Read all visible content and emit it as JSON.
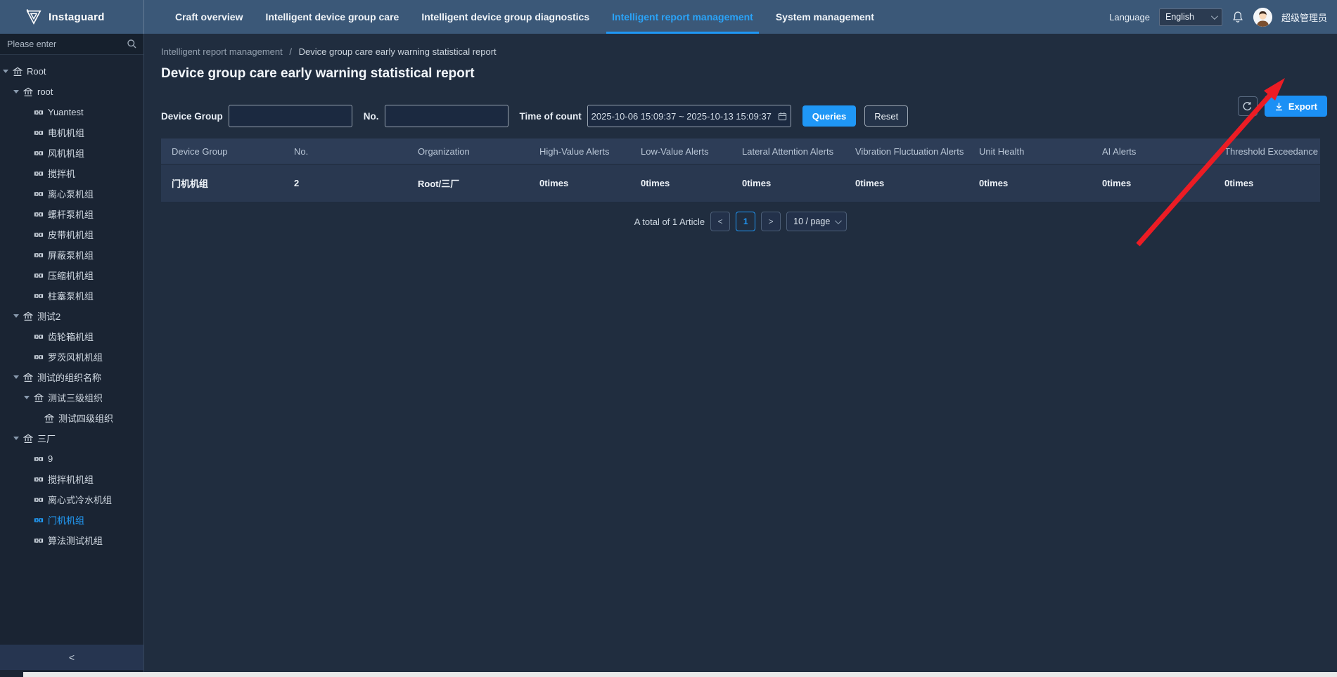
{
  "nav": {
    "logo_text": "Instaguard",
    "items": [
      {
        "label": "Craft overview",
        "active": false
      },
      {
        "label": "Intelligent device group care",
        "active": false
      },
      {
        "label": "Intelligent device group diagnostics",
        "active": false
      },
      {
        "label": "Intelligent report management",
        "active": true
      },
      {
        "label": "System management",
        "active": false
      }
    ],
    "language_label": "Language",
    "language_value": "English",
    "user_name": "超级管理员"
  },
  "sidebar": {
    "search_placeholder": "Please enter",
    "collapse_label": "<",
    "tree": [
      {
        "label": "Root",
        "level": 0,
        "icon": "org",
        "caret": true,
        "selected": false
      },
      {
        "label": "root",
        "level": 1,
        "icon": "org",
        "caret": true,
        "selected": false
      },
      {
        "label": "Yuantest",
        "level": 2,
        "icon": "device",
        "caret": false,
        "selected": false
      },
      {
        "label": "电机机组",
        "level": 2,
        "icon": "device",
        "caret": false,
        "selected": false
      },
      {
        "label": "风机机组",
        "level": 2,
        "icon": "device",
        "caret": false,
        "selected": false
      },
      {
        "label": "搅拌机",
        "level": 2,
        "icon": "device",
        "caret": false,
        "selected": false
      },
      {
        "label": "离心泵机组",
        "level": 2,
        "icon": "device",
        "caret": false,
        "selected": false
      },
      {
        "label": "螺杆泵机组",
        "level": 2,
        "icon": "device",
        "caret": false,
        "selected": false
      },
      {
        "label": "皮带机机组",
        "level": 2,
        "icon": "device",
        "caret": false,
        "selected": false
      },
      {
        "label": "屏蔽泵机组",
        "level": 2,
        "icon": "device",
        "caret": false,
        "selected": false
      },
      {
        "label": "压缩机机组",
        "level": 2,
        "icon": "device",
        "caret": false,
        "selected": false
      },
      {
        "label": "柱塞泵机组",
        "level": 2,
        "icon": "device",
        "caret": false,
        "selected": false
      },
      {
        "label": "测试2",
        "level": 1,
        "icon": "org",
        "caret": true,
        "selected": false
      },
      {
        "label": "齿轮箱机组",
        "level": 2,
        "icon": "device",
        "caret": false,
        "selected": false
      },
      {
        "label": "罗茨风机机组",
        "level": 2,
        "icon": "device",
        "caret": false,
        "selected": false
      },
      {
        "label": "测试的组织名称",
        "level": 1,
        "icon": "org",
        "caret": true,
        "selected": false
      },
      {
        "label": "测试三级组织",
        "level": 2,
        "icon": "org",
        "caret": true,
        "selected": false
      },
      {
        "label": "测试四级组织",
        "level": 3,
        "icon": "org",
        "caret": false,
        "selected": false
      },
      {
        "label": "三厂",
        "level": 1,
        "icon": "org",
        "caret": true,
        "selected": false
      },
      {
        "label": "9",
        "level": 2,
        "icon": "device",
        "caret": false,
        "selected": false
      },
      {
        "label": "搅拌机机组",
        "level": 2,
        "icon": "device",
        "caret": false,
        "selected": false
      },
      {
        "label": "离心式冷水机组",
        "level": 2,
        "icon": "device",
        "caret": false,
        "selected": false
      },
      {
        "label": "门机机组",
        "level": 2,
        "icon": "device",
        "caret": false,
        "selected": true
      },
      {
        "label": "算法测试机组",
        "level": 2,
        "icon": "device",
        "caret": false,
        "selected": false
      }
    ]
  },
  "breadcrumb": {
    "parent": "Intelligent report management",
    "separator": "/",
    "current": "Device group care early warning statistical report"
  },
  "page": {
    "title": "Device group care early warning statistical report",
    "export_label": "Export"
  },
  "filters": {
    "device_group_label": "Device Group",
    "device_group_value": "",
    "no_label": "No.",
    "no_value": "",
    "time_label": "Time of count",
    "time_value": "2025-10-06 15:09:37 ~ 2025-10-13 15:09:37",
    "queries_label": "Queries",
    "reset_label": "Reset"
  },
  "table": {
    "headers": [
      "Device Group",
      "No.",
      "Organization",
      "High-Value Alerts",
      "Low-Value Alerts",
      "Lateral Attention Alerts",
      "Vibration Fluctuation Alerts",
      "Unit Health",
      "AI Alerts",
      "Threshold Exceedance"
    ],
    "rows": [
      [
        "门机机组",
        "2",
        "Root/三厂",
        "0times",
        "0times",
        "0times",
        "0times",
        "0times",
        "0times",
        "0times"
      ]
    ]
  },
  "pagination": {
    "total_text": "A total of 1 Article",
    "prev_label": "<",
    "page_label": "1",
    "next_label": ">",
    "page_size_label": "10 / page"
  },
  "colors": {
    "accent": "#1f97f6",
    "nav_bg": "#3b5878",
    "page_bg": "#202d3f",
    "annotation_arrow": "#ec1c24"
  }
}
